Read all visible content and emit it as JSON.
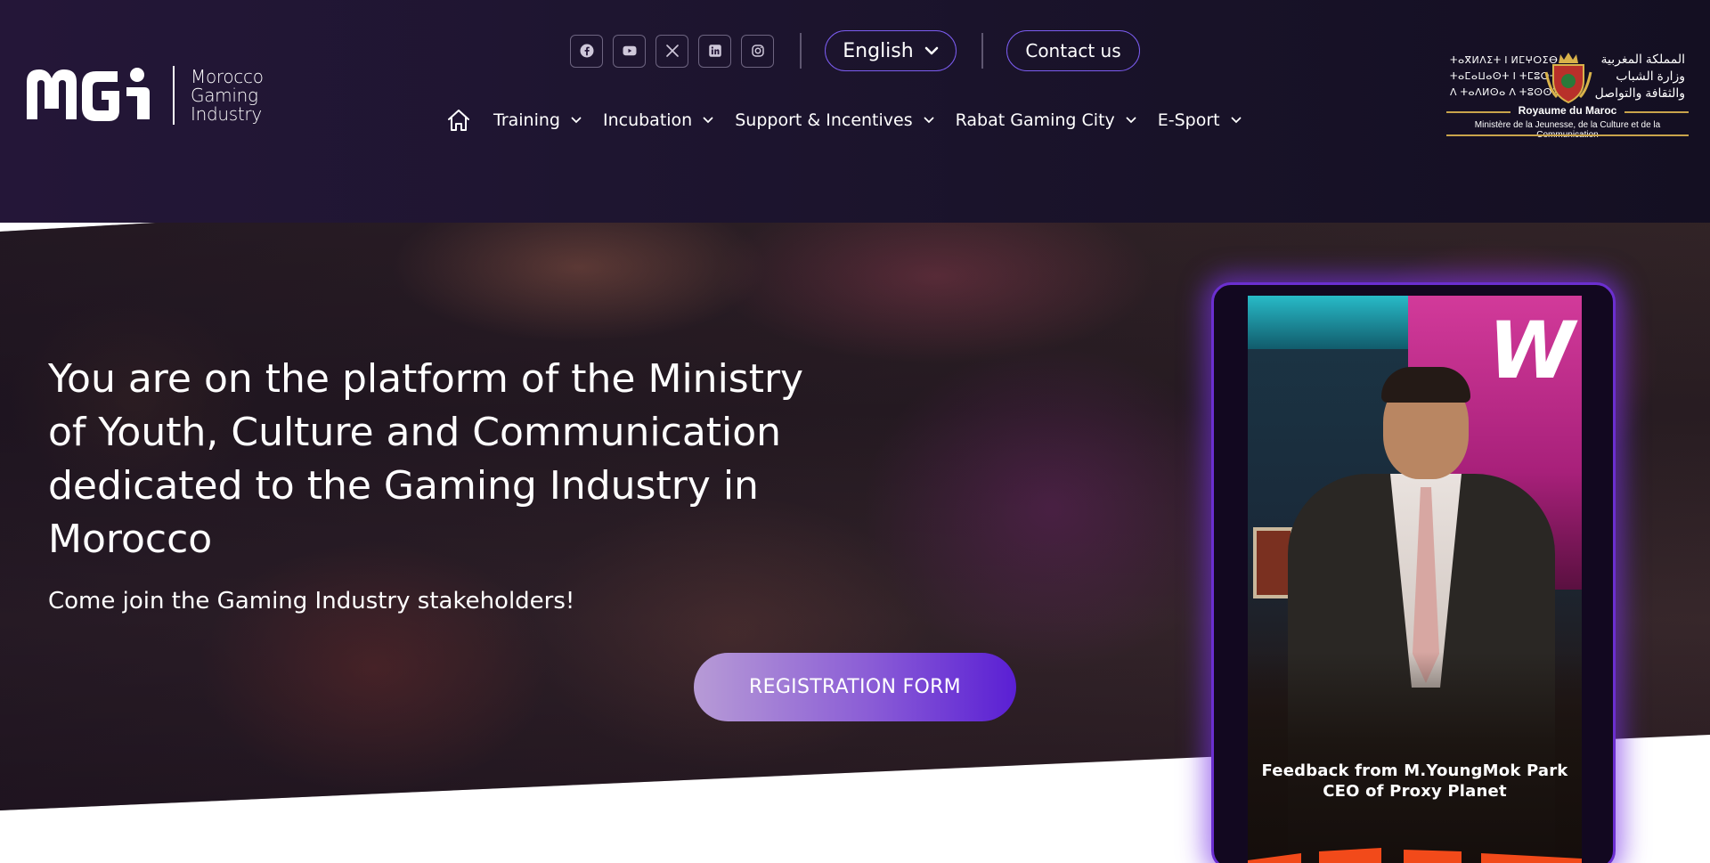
{
  "brand": {
    "logo_letters": "MGI",
    "logo_text": [
      "Morocco",
      "Gaming",
      "Industry"
    ]
  },
  "social": [
    "facebook-icon",
    "youtube-icon",
    "x-icon",
    "linkedin-icon",
    "instagram-icon"
  ],
  "language": {
    "selected": "English"
  },
  "contact_label": "Contact us",
  "nav": {
    "items": [
      {
        "label": "Training"
      },
      {
        "label": "Incubation"
      },
      {
        "label": "Support & Incentives"
      },
      {
        "label": "Rabat Gaming City"
      },
      {
        "label": "E-Sport"
      }
    ]
  },
  "ministry": {
    "tifinagh": [
      "ⵜⴰⴳⵍⴷⵉⵜ ⵏ ⵍⵎⵖⵔⵉⴱ",
      "ⵜⴰⵎⴰⵡⴰⵙⵜ ⵏ ⵜⵎⵓⵔⵜ",
      "ⴷ ⵜⴰⴷⵍⵙⴰ ⴷ ⵜⵓⵙⵙⵉⵡⵍⵜ"
    ],
    "arabic": [
      "المملكة المغربية",
      "وزارة الشباب",
      "والثقافة والتواصل"
    ],
    "royaume": "Royaume du Maroc",
    "ministere": "Ministère de la Jeunesse, de la Culture et de la Communication"
  },
  "hero": {
    "title": "You are on the platform of the Ministry of Youth, Culture and Communication dedicated to the Gaming Industry in Morocco",
    "subtitle": "Come join the Gaming Industry stakeholders!",
    "cta": "REGISTRATION FORM"
  },
  "video": {
    "caption_line1": "Feedback from M.YoungMok Park",
    "caption_line2": "CEO of Proxy Planet",
    "sign_letter": "W"
  },
  "colors": {
    "header_bg": "#1e1530",
    "accent_purple": "#7b5cf0",
    "cta_gradient_end": "#5a1fd4",
    "video_glow": "#6b2fd0",
    "ministry_gold": "#c9a44b"
  }
}
